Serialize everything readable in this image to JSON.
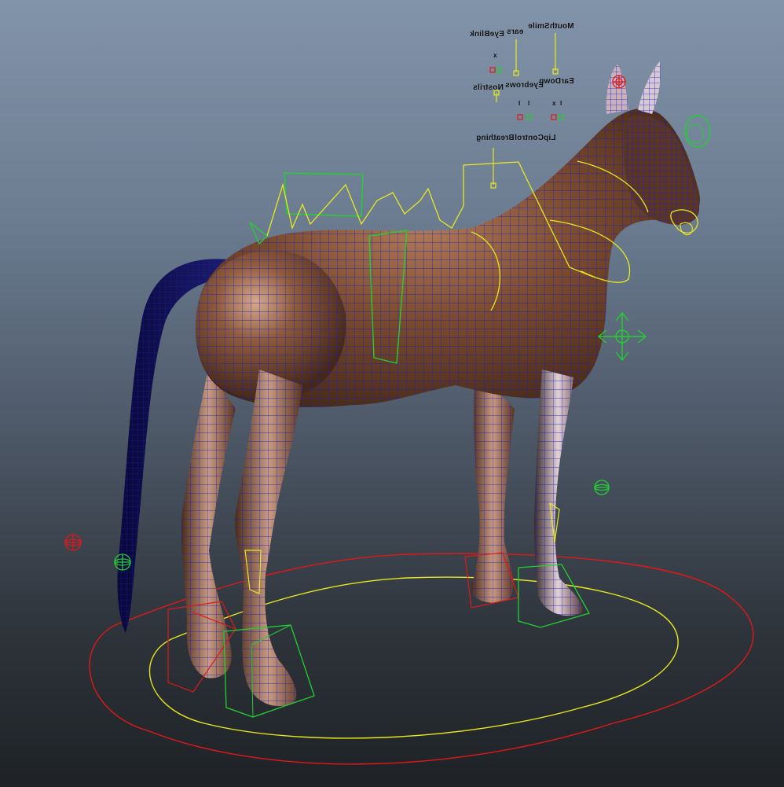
{
  "viewport": {
    "background_top": "#8294a9",
    "background_bottom": "#1e2226",
    "wire_color": "#1f1fbf",
    "skin_color": "#7a4a2e",
    "ctrl_red": "#e01818",
    "ctrl_yellow": "#e8e820",
    "ctrl_green": "#22d030"
  },
  "facial_controls": {
    "mouth_label": "MouthSmile",
    "ears_label": "ears",
    "eye_blink_label": "EyeBlink",
    "ear_down_label": "EarDown",
    "eyebrows_label": "Eyebrows",
    "nostrils_label": "Nostrils",
    "lip_control_label": "LipControl",
    "breathing_label": "Breathing",
    "axis_x": "x",
    "axis_l": "l"
  },
  "icons": {
    "move_manipulator": "four-way-arrow-icon",
    "locator_red": "sphere-locator-icon",
    "locator_green": "sphere-locator-icon"
  }
}
